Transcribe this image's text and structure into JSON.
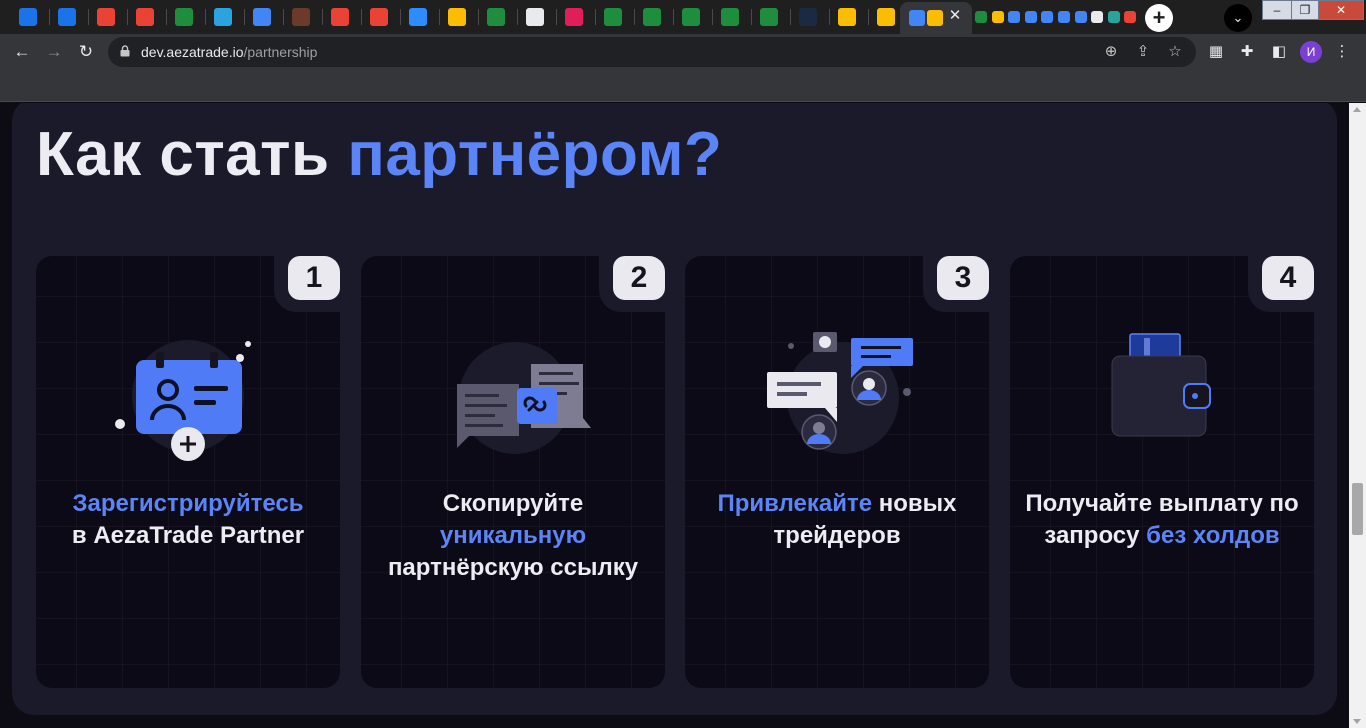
{
  "browser": {
    "url_domain": "dev.aezatrade.io",
    "url_path": "/partnership",
    "profile_initial": "И",
    "tab_icons": [
      {
        "name": "outlook-icon",
        "color": "#1a73e8"
      },
      {
        "name": "outlook-icon",
        "color": "#1a73e8"
      },
      {
        "name": "gmail-icon",
        "color": "#ea4335"
      },
      {
        "name": "gmail-icon",
        "color": "#ea4335"
      },
      {
        "name": "sheets-icon",
        "color": "#1e8e3e"
      },
      {
        "name": "telegram-icon",
        "color": "#2aa3df"
      },
      {
        "name": "docs-icon",
        "color": "#4285f4"
      },
      {
        "name": "app-icon",
        "color": "#6b3a2a"
      },
      {
        "name": "gmail-icon",
        "color": "#ea4335"
      },
      {
        "name": "gmail-icon",
        "color": "#ea4335"
      },
      {
        "name": "zoom-icon",
        "color": "#2d8cff"
      },
      {
        "name": "drive-icon",
        "color": "#fbbc04"
      },
      {
        "name": "sheets-icon",
        "color": "#1e8e3e"
      },
      {
        "name": "globe-icon",
        "color": "#e8eaed"
      },
      {
        "name": "slack-icon",
        "color": "#e01e5a"
      },
      {
        "name": "sheets-icon",
        "color": "#1e8e3e"
      },
      {
        "name": "sheets-icon",
        "color": "#1e8e3e"
      },
      {
        "name": "sheets-icon",
        "color": "#1e8e3e"
      },
      {
        "name": "sheets-icon",
        "color": "#1e8e3e"
      },
      {
        "name": "sheets-icon",
        "color": "#1e8e3e"
      },
      {
        "name": "app-icon",
        "color": "#1b2a44"
      },
      {
        "name": "drive-icon",
        "color": "#fbbc04"
      },
      {
        "name": "drive-icon",
        "color": "#fbbc04"
      }
    ],
    "tab_icons_right": [
      {
        "name": "sheets-icon",
        "color": "#1e8e3e"
      },
      {
        "name": "drive-icon",
        "color": "#fbbc04"
      },
      {
        "name": "docs-icon",
        "color": "#4285f4"
      },
      {
        "name": "docs-icon",
        "color": "#4285f4"
      },
      {
        "name": "docs-icon",
        "color": "#4285f4"
      },
      {
        "name": "docs-icon",
        "color": "#4285f4"
      },
      {
        "name": "docs-icon",
        "color": "#4285f4"
      },
      {
        "name": "app-icon",
        "color": "#e8eaed"
      },
      {
        "name": "app-icon",
        "color": "#2aa39b"
      },
      {
        "name": "google-icon",
        "color": "#ea4335"
      }
    ]
  },
  "page": {
    "heading_main": "Как стать ",
    "heading_accent": "партнёром?",
    "steps": [
      {
        "number": "1",
        "parts": [
          [
            "Зарегистрируйтесь",
            true
          ],
          [
            " в AezaTrade Partner",
            false
          ]
        ]
      },
      {
        "number": "2",
        "parts": [
          [
            "Скопируйте ",
            false
          ],
          [
            "уникальную",
            true
          ],
          [
            " партнёрскую ссылку",
            false
          ]
        ]
      },
      {
        "number": "3",
        "parts": [
          [
            "Привлекайте",
            true
          ],
          [
            " новых трейдеров",
            false
          ]
        ]
      },
      {
        "number": "4",
        "parts": [
          [
            "Получайте выплату по запросу ",
            false
          ],
          [
            "без холдов",
            true
          ]
        ]
      }
    ],
    "step_1_accent": "Зарегистрируйтесь",
    "step_1_plain": "в AezaTrade Partner",
    "step_2_plain_a": "Скопируйте",
    "step_2_accent": "уникальную",
    "step_2_plain_b": "партнёрскую ссылку",
    "step_3_accent": "Привлекайте",
    "step_3_plain": "новых трейдеров",
    "step_4_plain": "Получайте выплату по запросу",
    "step_4_accent": "без холдов"
  },
  "colors": {
    "accent": "#5b84f7",
    "text": "#ececf2",
    "panel": "#1b1a2b",
    "card": "#0b0a16"
  }
}
